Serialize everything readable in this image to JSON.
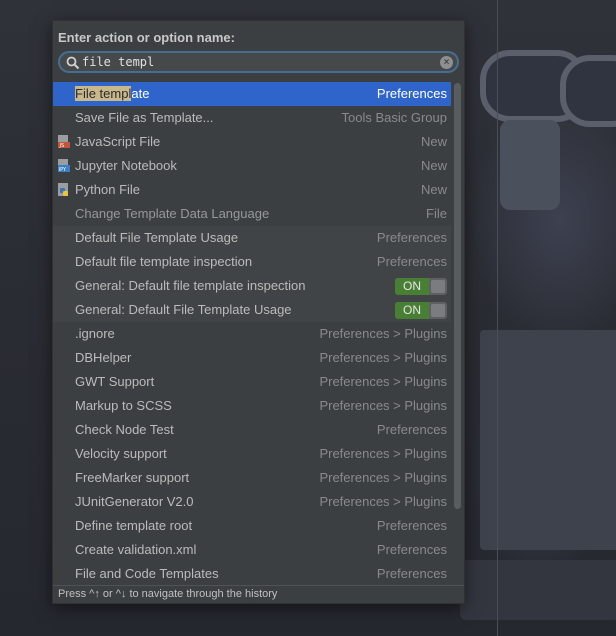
{
  "popup": {
    "title": "Enter action or option name:",
    "search": {
      "value": "file templ",
      "placeholder": ""
    },
    "footer": "Press ^↑ or ^↓ to navigate through the history"
  },
  "results": [
    {
      "label_hl": "File templ",
      "label_rest": "ate",
      "right": "Preferences",
      "selected": true
    },
    {
      "label": "Save File as Template...",
      "right": "Tools Basic Group"
    },
    {
      "label": "JavaScript File",
      "right": "New",
      "icon": "javascript-file-icon"
    },
    {
      "label": "Jupyter Notebook",
      "right": "New",
      "icon": "jupyter-notebook-icon"
    },
    {
      "label": "Python File",
      "right": "New",
      "icon": "python-file-icon"
    },
    {
      "label": "Change Template Data Language",
      "right": "File"
    },
    {
      "label": "Default File Template Usage",
      "right": "Preferences"
    },
    {
      "label": "Default file template inspection",
      "right": "Preferences"
    },
    {
      "label": "General: Default file template inspection",
      "toggle": "ON"
    },
    {
      "label": "General: Default File Template Usage",
      "toggle": "ON"
    },
    {
      "label": ".ignore",
      "right": "Preferences > Plugins"
    },
    {
      "label": "DBHelper",
      "right": "Preferences > Plugins"
    },
    {
      "label": "GWT Support",
      "right": "Preferences > Plugins"
    },
    {
      "label": "Markup to SCSS",
      "right": "Preferences > Plugins"
    },
    {
      "label": "Check Node Test",
      "right": "Preferences"
    },
    {
      "label": "Velocity support",
      "right": "Preferences > Plugins"
    },
    {
      "label": "FreeMarker support",
      "right": "Preferences > Plugins"
    },
    {
      "label": "JUnitGenerator V2.0",
      "right": "Preferences > Plugins"
    },
    {
      "label": "Define template root",
      "right": "Preferences"
    },
    {
      "label": "Create validation.xml",
      "right": "Preferences"
    },
    {
      "label": "File and Code Templates",
      "right": "Preferences"
    }
  ],
  "colors": {
    "selection": "#2f65ca",
    "toggle_on": "#497e35",
    "search_border": "#466d94"
  }
}
